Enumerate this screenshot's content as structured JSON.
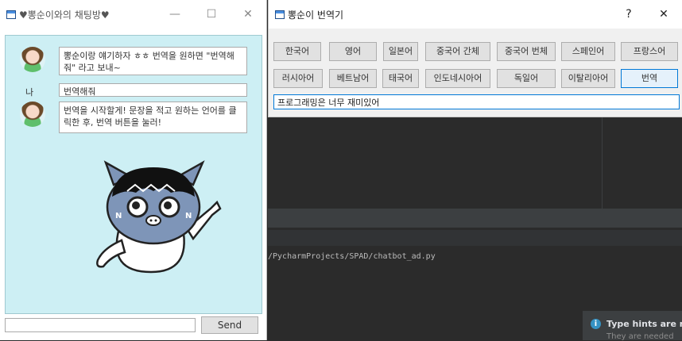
{
  "ide": {
    "console_path": "/PycharmProjects/SPAD/chatbot_ad.py",
    "toast_title": "Type hints are ne",
    "toast_sub": "They are needed",
    "toast_icon": "info-icon"
  },
  "chat_window": {
    "title": "♥뽕순이와의 채팅방♥",
    "buttons": {
      "minimize": "—",
      "maximize": "☐",
      "close": "✕"
    },
    "messages": [
      {
        "sender": "bot",
        "text": "뽕순이랑 얘기하자 ㅎㅎ 번역을 원하면 \"번역해줘\" 라고 보내~"
      },
      {
        "sender": "me",
        "label": "나",
        "text": "번역해줘"
      },
      {
        "sender": "bot",
        "text": "번역을 시작할게! 문장을 적고 원하는 언어를 클릭한 후, 번역 버튼을 눌러!"
      }
    ],
    "input_value": "",
    "send_label": "Send"
  },
  "translator_window": {
    "title": "뽕순이 번역기",
    "buttons": {
      "help": "?",
      "close": "✕"
    },
    "row1": [
      "한국어",
      "영어",
      "일본어",
      "중국어 간체",
      "중국어 번체",
      "스페인어",
      "프랑스어"
    ],
    "row2": [
      "러시아어",
      "베트남어",
      "태국어",
      "인도네시아어",
      "독일어",
      "이탈리아어",
      "번역"
    ],
    "input_value": "프로그래밍은 너무 재미있어"
  }
}
